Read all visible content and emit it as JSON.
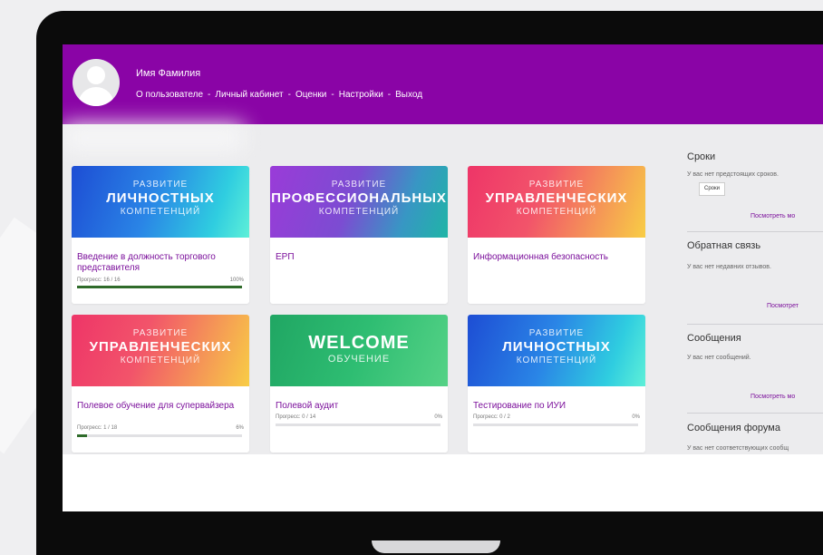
{
  "user": {
    "name": "Имя Фамилия"
  },
  "nav": [
    "О пользователе",
    "Личный кабинет",
    "Оценки",
    "Настройки",
    "Выход"
  ],
  "nav_separator": "-",
  "courses": [
    {
      "banner": [
        "РАЗВИТИЕ",
        "ЛИЧНОСТНЫХ",
        "КОМПЕТЕНЦИЙ"
      ],
      "title": "Введение в должность торгового представителя",
      "progress": "Прогресс: 16 / 16",
      "percent": "100%",
      "progress_fraction": 1.0
    },
    {
      "banner": [
        "РАЗВИТИЕ",
        "ПРОФЕССИОНАЛЬНЫХ",
        "КОМПЕТЕНЦИЙ"
      ],
      "title": "ЕРП",
      "progress": "",
      "percent": ""
    },
    {
      "banner": [
        "РАЗВИТИЕ",
        "УПРАВЛЕНЧЕСКИХ",
        "КОМПЕТЕНЦИЙ"
      ],
      "title": "Информационная безопасность",
      "progress": "",
      "percent": ""
    },
    {
      "banner": [
        "РАЗВИТИЕ",
        "УПРАВЛЕНЧЕСКИХ",
        "КОМПЕТЕНЦИЙ"
      ],
      "title": "Полевое обучение для супервайзера",
      "progress": "Прогресс: 1 / 18",
      "percent": "6%",
      "progress_fraction": 0.06
    },
    {
      "banner": [
        "WELCOME",
        "ОБУЧЕНИЕ"
      ],
      "title": "Полевой аудит",
      "progress": "Прогресс: 0 / 14",
      "percent": "0%",
      "progress_fraction": 0
    },
    {
      "banner": [
        "РАЗВИТИЕ",
        "ЛИЧНОСТНЫХ",
        "КОМПЕТЕНЦИЙ"
      ],
      "title": "Тестирование по ИУИ",
      "progress": "Прогресс: 0 / 2",
      "percent": "0%",
      "progress_fraction": 0
    }
  ],
  "sidebar": {
    "deadlines": {
      "title": "Сроки",
      "text": "У вас нет предстоящих сроков.",
      "button": "Сроки",
      "link": "Посмотреть мо"
    },
    "feedback": {
      "title": "Обратная связь",
      "text": "У вас нет недавних отзывов.",
      "link": "Посмотрет"
    },
    "messages": {
      "title": "Сообщения",
      "text": "У вас нет сообщений.",
      "link": "Посмотреть мо"
    },
    "forum": {
      "title": "Сообщения форума",
      "text": "У вас нет соответствующих сообщ"
    }
  },
  "colors": {
    "header": "#8a04a6",
    "accent": "#7b0f9b",
    "progress_fill": "#2f6b2a"
  }
}
